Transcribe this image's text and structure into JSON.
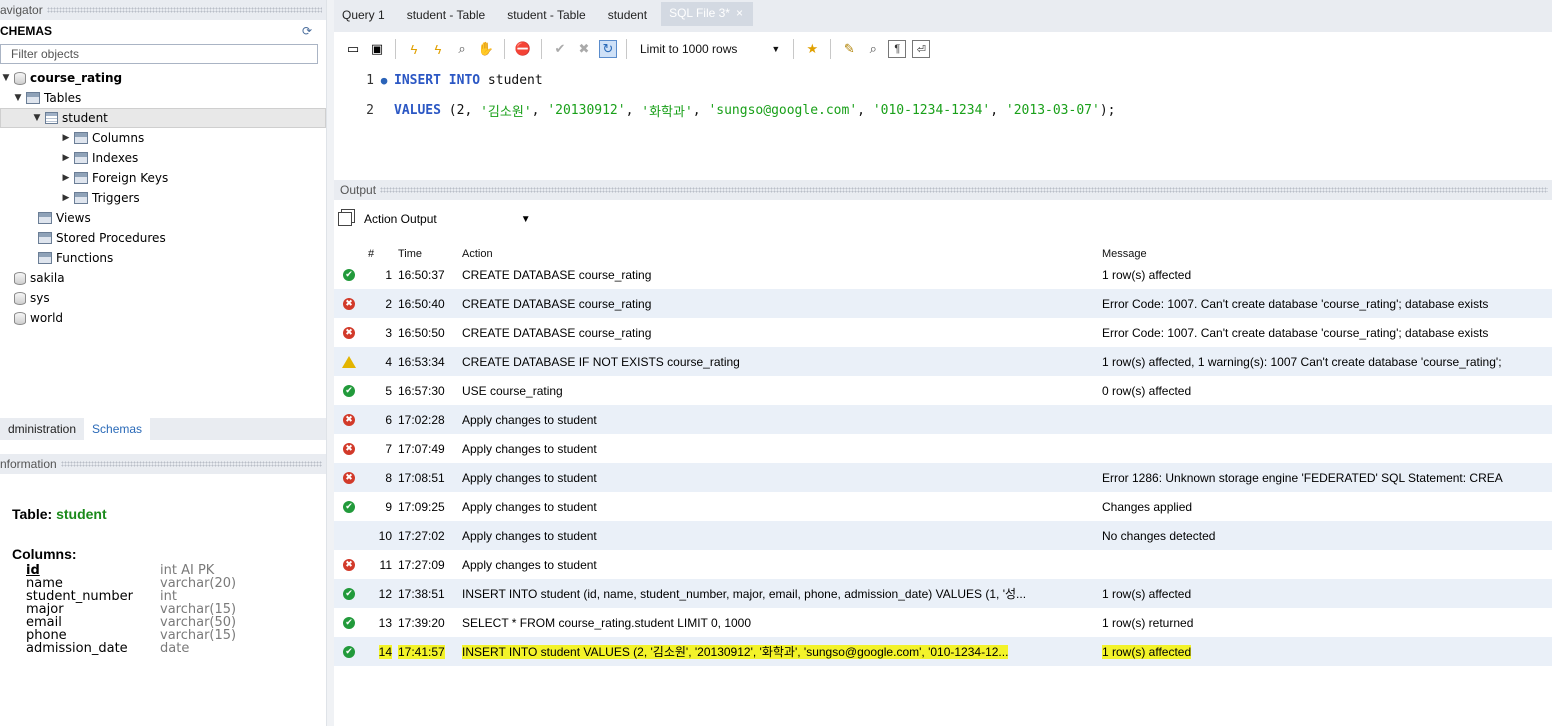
{
  "navigator": {
    "header": "avigator",
    "schemas_label": "CHEMAS",
    "filter_placeholder": "Filter objects",
    "tree": [
      {
        "label": "course_rating",
        "arrow": "▼",
        "icon": "database-icon",
        "bold": true
      },
      {
        "label": "Tables",
        "arrow": "▼",
        "icon": "folder-icon"
      },
      {
        "label": "student",
        "arrow": "▼",
        "icon": "table-icon"
      },
      {
        "label": "Columns",
        "arrow": "▶",
        "icon": "columns-icon"
      },
      {
        "label": "Indexes",
        "arrow": "▶",
        "icon": "folder-icon"
      },
      {
        "label": "Foreign Keys",
        "arrow": "▶",
        "icon": "folder-icon"
      },
      {
        "label": "Triggers",
        "arrow": "▶",
        "icon": "folder-icon"
      },
      {
        "label": "Views",
        "icon": "folder-icon"
      },
      {
        "label": "Stored Procedures",
        "icon": "folder-icon"
      },
      {
        "label": "Functions",
        "icon": "folder-icon"
      },
      {
        "label": "sakila",
        "icon": "database-icon"
      },
      {
        "label": "sys",
        "icon": "database-icon"
      },
      {
        "label": "world",
        "icon": "database-icon"
      }
    ],
    "tab_administration": "dministration",
    "tab_schemas": "Schemas"
  },
  "information": {
    "header": "nformation",
    "table_prefix": "Table: ",
    "table_name": "student",
    "columns_label": "Columns:",
    "columns": [
      {
        "name": "id",
        "type": "int AI PK"
      },
      {
        "name": "name",
        "type": "varchar(20)"
      },
      {
        "name": "student_number",
        "type": "int"
      },
      {
        "name": "major",
        "type": "varchar(15)"
      },
      {
        "name": "email",
        "type": "varchar(50)"
      },
      {
        "name": "phone",
        "type": "varchar(15)"
      },
      {
        "name": "admission_date",
        "type": "date"
      }
    ]
  },
  "tabs": [
    {
      "label": "Query 1"
    },
    {
      "label": "student - Table"
    },
    {
      "label": "student - Table"
    },
    {
      "label": "student"
    },
    {
      "label": "SQL File 3*",
      "active": true
    }
  ],
  "toolbar": {
    "limit_label": "Limit to 1000 rows"
  },
  "editor": {
    "line1_num": "1",
    "line2_num": "2",
    "line1_kw": "INSERT INTO",
    "line1_rest": " student",
    "line2_kw": "VALUES",
    "line2_a": " (2, ",
    "line2_s1": "'김소원'",
    "line2_b": ", ",
    "line2_s2": "'20130912'",
    "line2_c": ", ",
    "line2_s3": "'화학과'",
    "line2_d": ", ",
    "line2_s4": "'sungso@google.com'",
    "line2_e": ", ",
    "line2_s5": "'010-1234-1234'",
    "line2_f": ", ",
    "line2_s6": "'2013-03-07'",
    "line2_g": ");"
  },
  "output": {
    "header": "Output",
    "selector": "Action Output",
    "columns": {
      "num": "#",
      "time": "Time",
      "action": "Action",
      "message": "Message"
    },
    "rows": [
      {
        "status": "ok",
        "num": "1",
        "time": "16:50:37",
        "action": "CREATE DATABASE course_rating",
        "message": "1 row(s) affected"
      },
      {
        "status": "err",
        "num": "2",
        "time": "16:50:40",
        "action": "CREATE DATABASE course_rating",
        "message": "Error Code: 1007. Can't create database 'course_rating'; database exists"
      },
      {
        "status": "err",
        "num": "3",
        "time": "16:50:50",
        "action": "CREATE DATABASE course_rating",
        "message": "Error Code: 1007. Can't create database 'course_rating'; database exists"
      },
      {
        "status": "warn",
        "num": "4",
        "time": "16:53:34",
        "action": "CREATE DATABASE IF NOT EXISTS course_rating",
        "message": "1 row(s) affected, 1 warning(s): 1007 Can't create database 'course_rating';"
      },
      {
        "status": "ok",
        "num": "5",
        "time": "16:57:30",
        "action": "USE course_rating",
        "message": "0 row(s) affected"
      },
      {
        "status": "err",
        "num": "6",
        "time": "17:02:28",
        "action": "Apply changes to student",
        "message": ""
      },
      {
        "status": "err",
        "num": "7",
        "time": "17:07:49",
        "action": "Apply changes to student",
        "message": ""
      },
      {
        "status": "err",
        "num": "8",
        "time": "17:08:51",
        "action": "Apply changes to student",
        "message": "Error 1286: Unknown storage engine 'FEDERATED' SQL Statement: CREA"
      },
      {
        "status": "ok",
        "num": "9",
        "time": "17:09:25",
        "action": "Apply changes to student",
        "message": "Changes applied"
      },
      {
        "status": "info",
        "num": "10",
        "time": "17:27:02",
        "action": "Apply changes to student",
        "message": "No changes detected"
      },
      {
        "status": "err",
        "num": "11",
        "time": "17:27:09",
        "action": "Apply changes to student",
        "message": ""
      },
      {
        "status": "ok",
        "num": "12",
        "time": "17:38:51",
        "action": "INSERT INTO student  (id, name, student_number, major, email, phone, admission_date) VALUES (1, '성...",
        "message": "1 row(s) affected"
      },
      {
        "status": "ok",
        "num": "13",
        "time": "17:39:20",
        "action": "SELECT * FROM course_rating.student LIMIT 0, 1000",
        "message": "1 row(s) returned"
      },
      {
        "status": "ok",
        "num": "14",
        "time": "17:41:57",
        "action": "INSERT INTO student  VALUES (2, '김소원', '20130912', '화학과', 'sungso@google.com', '010-1234-12...",
        "message": "1 row(s) affected",
        "highlight": true
      }
    ]
  }
}
